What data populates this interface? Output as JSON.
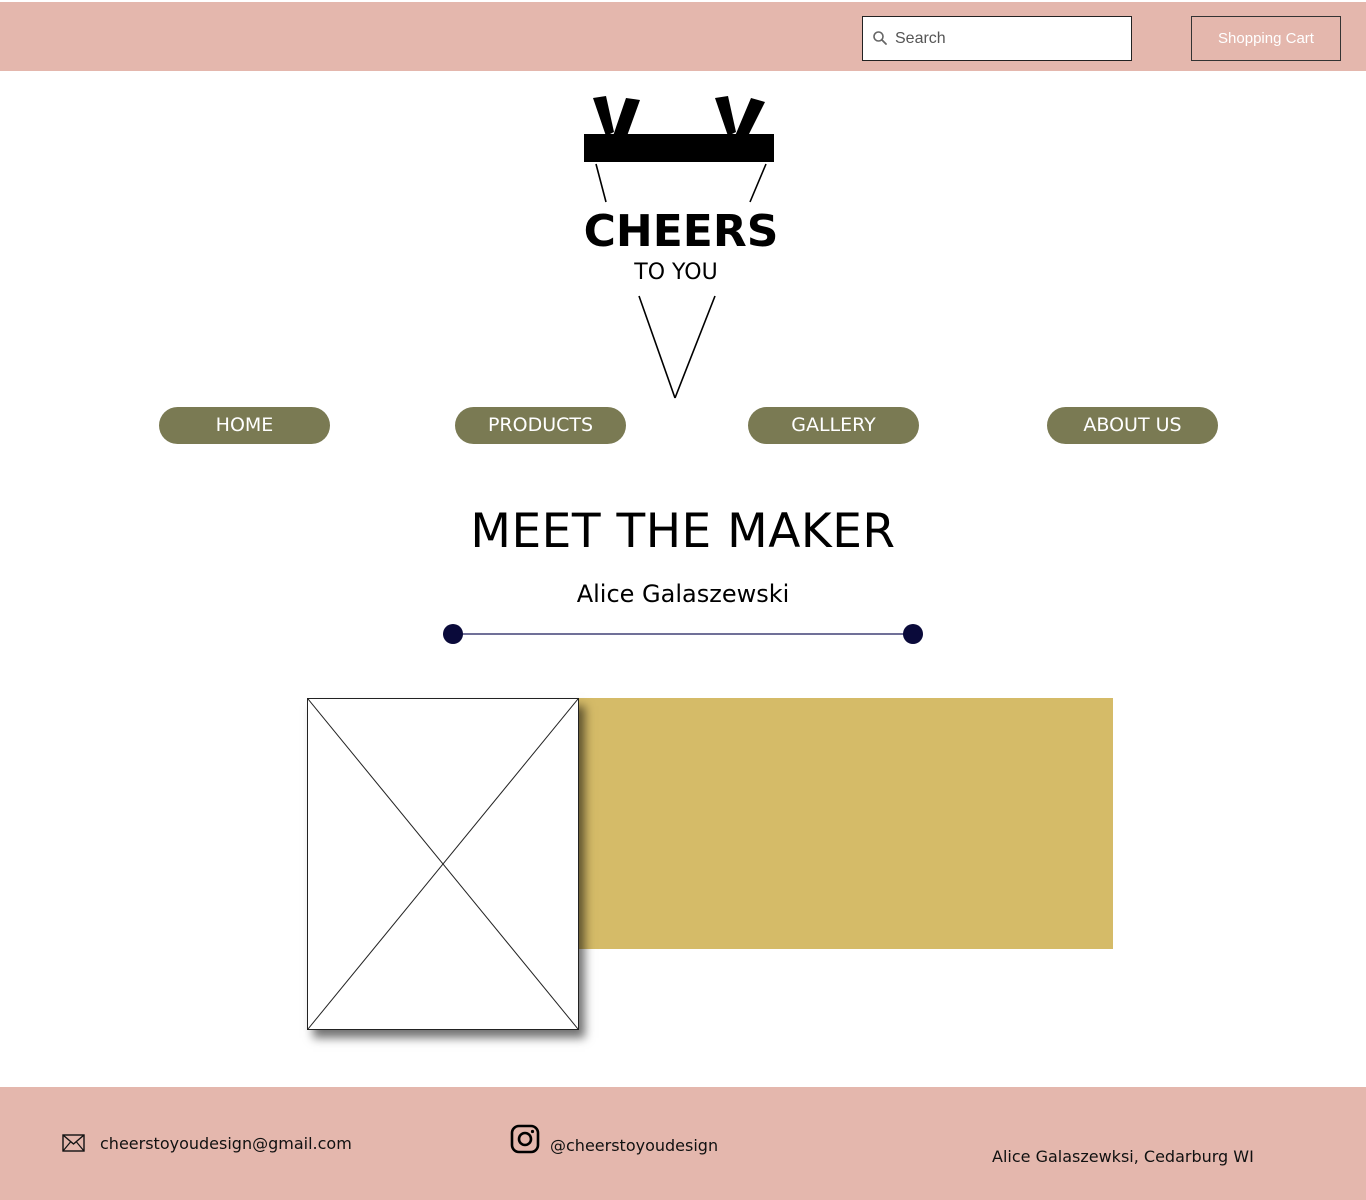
{
  "header": {
    "search_placeholder": "Search",
    "cart_label": "Shopping Cart"
  },
  "logo": {
    "brand": "CHEERS",
    "tagline": "TO YOU"
  },
  "nav": {
    "items": [
      {
        "label": "HOME"
      },
      {
        "label": "PRODUCTS"
      },
      {
        "label": "GALLERY"
      },
      {
        "label": "ABOUT US"
      }
    ]
  },
  "main": {
    "title": "MEET THE MAKER",
    "subtitle": "Alice Galaszewski"
  },
  "footer": {
    "email": "cheerstoyoudesign@gmail.com",
    "instagram": "@cheerstoyoudesign",
    "location": "Alice Galaszewksi, Cedarburg WI"
  },
  "icons": {
    "search": "search-icon",
    "mail": "mail-icon",
    "instagram": "instagram-icon"
  },
  "colors": {
    "header_footer_bg": "#e4b7ad",
    "nav_pill": "#7a7a53",
    "gold_block": "#d5bb68",
    "divider_dot": "#0a0a3a"
  }
}
